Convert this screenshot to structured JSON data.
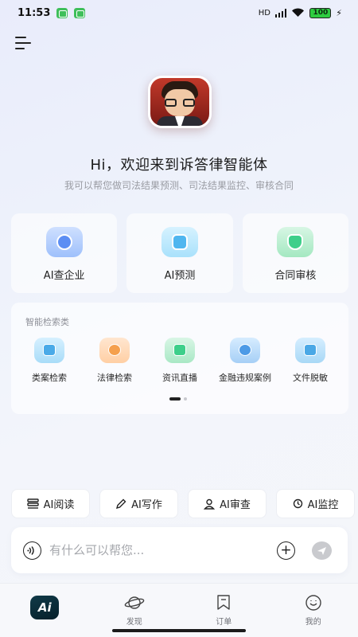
{
  "status_bar": {
    "time": "11:53",
    "battery": "100",
    "network": "HD"
  },
  "greeting": {
    "title": "Hi，欢迎来到诉答律智能体",
    "subtitle": "我可以帮您做司法结果预测、司法结果监控、审核合同"
  },
  "features": [
    {
      "label": "AI查企业",
      "icon": "enterprise-search-icon"
    },
    {
      "label": "AI预测",
      "icon": "prediction-icon"
    },
    {
      "label": "合同审核",
      "icon": "contract-review-icon"
    }
  ],
  "smart_search": {
    "title": "智能检索类",
    "items": [
      {
        "label": "类案检索",
        "icon": "case-search-icon"
      },
      {
        "label": "法律检索",
        "icon": "law-search-icon"
      },
      {
        "label": "资讯直播",
        "icon": "news-live-icon"
      },
      {
        "label": "金融违规案例",
        "icon": "finance-violation-icon"
      },
      {
        "label": "文件脱敏",
        "icon": "file-desensitize-icon"
      }
    ],
    "page": 1,
    "page_count": 2
  },
  "quick_actions": [
    {
      "label": "AI阅读",
      "icon": "reading-icon"
    },
    {
      "label": "AI写作",
      "icon": "pen-icon"
    },
    {
      "label": "AI审查",
      "icon": "user-check-icon"
    },
    {
      "label": "AI监控",
      "icon": "monitor-icon"
    }
  ],
  "input": {
    "placeholder": "有什么可以帮您..."
  },
  "bottom_nav": {
    "home_badge": "Ai",
    "items": [
      {
        "label": "发现",
        "icon": "planet-icon"
      },
      {
        "label": "订单",
        "icon": "bookmark-icon"
      },
      {
        "label": "我的",
        "icon": "smile-icon"
      }
    ]
  }
}
